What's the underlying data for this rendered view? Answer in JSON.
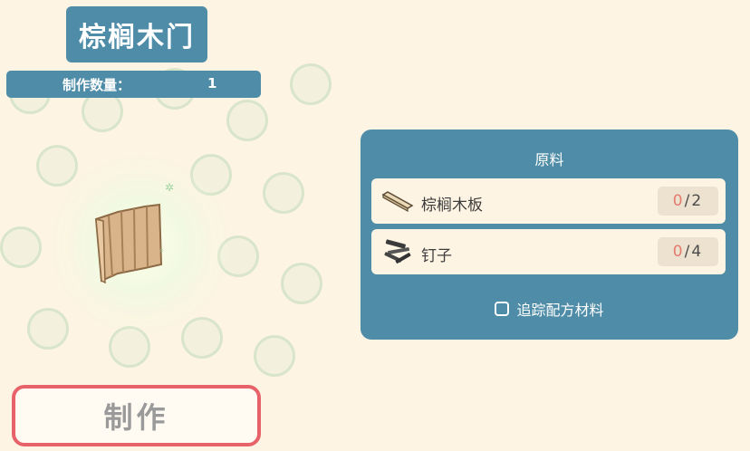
{
  "item": {
    "title": "棕榈木门",
    "quantity_label": "制作数量：",
    "quantity_value": "1",
    "icon": "palm-wood-door-icon"
  },
  "craft_button": {
    "label": "制作",
    "border_color": "#e8626a"
  },
  "materials_panel": {
    "title": "原料",
    "materials": [
      {
        "name": "棕榈木板",
        "have": "0",
        "separator": "/",
        "need": "2",
        "icon": "wood-plank-icon"
      },
      {
        "name": "钉子",
        "have": "0",
        "separator": "/",
        "need": "4",
        "icon": "nails-icon"
      }
    ],
    "track_label": "追踪配方材料"
  },
  "colors": {
    "panel": "#4f8ca7",
    "background": "#fdf4e3",
    "have_count": "#e47b6f"
  }
}
